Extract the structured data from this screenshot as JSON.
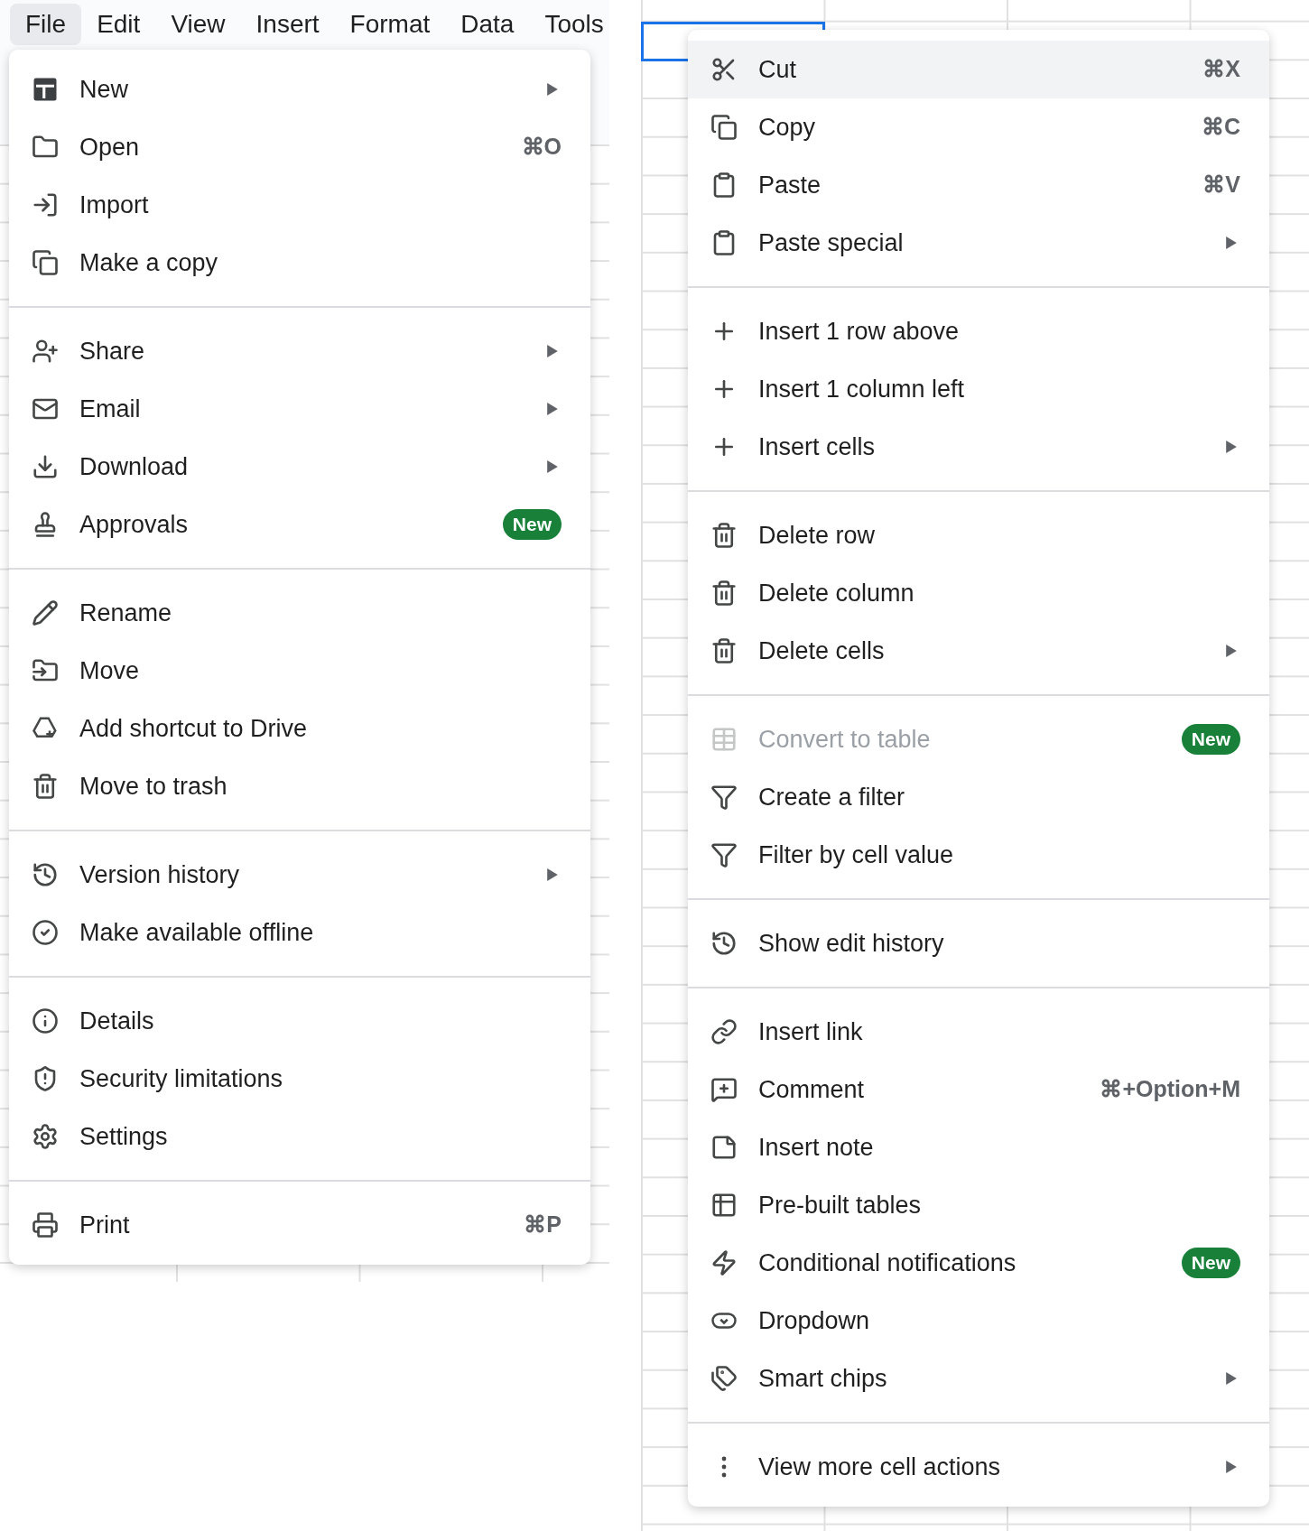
{
  "menubar": [
    {
      "label": "File",
      "selected": true
    },
    {
      "label": "Edit",
      "selected": false
    },
    {
      "label": "View",
      "selected": false
    },
    {
      "label": "Insert",
      "selected": false
    },
    {
      "label": "Format",
      "selected": false
    },
    {
      "label": "Data",
      "selected": false
    },
    {
      "label": "Tools",
      "selected": false
    }
  ],
  "file_menu": {
    "sections": [
      [
        {
          "label": "New",
          "submenu": true
        },
        {
          "label": "Open",
          "shortcut": "⌘O"
        },
        {
          "label": "Import"
        },
        {
          "label": "Make a copy"
        }
      ],
      [
        {
          "label": "Share",
          "submenu": true
        },
        {
          "label": "Email",
          "submenu": true
        },
        {
          "label": "Download",
          "submenu": true
        },
        {
          "label": "Approvals",
          "badge": "New"
        }
      ],
      [
        {
          "label": "Rename"
        },
        {
          "label": "Move"
        },
        {
          "label": "Add shortcut to Drive"
        },
        {
          "label": "Move to trash"
        }
      ],
      [
        {
          "label": "Version history",
          "submenu": true
        },
        {
          "label": "Make available offline"
        }
      ],
      [
        {
          "label": "Details"
        },
        {
          "label": "Security limitations"
        },
        {
          "label": "Settings"
        }
      ],
      [
        {
          "label": "Print",
          "shortcut": "⌘P"
        }
      ]
    ]
  },
  "context_menu": {
    "sections": [
      [
        {
          "label": "Cut",
          "shortcut": "⌘X",
          "highlighted": true
        },
        {
          "label": "Copy",
          "shortcut": "⌘C"
        },
        {
          "label": "Paste",
          "shortcut": "⌘V"
        },
        {
          "label": "Paste special",
          "submenu": true
        }
      ],
      [
        {
          "label": "Insert 1 row above"
        },
        {
          "label": "Insert 1 column left"
        },
        {
          "label": "Insert cells",
          "submenu": true
        }
      ],
      [
        {
          "label": "Delete row"
        },
        {
          "label": "Delete column"
        },
        {
          "label": "Delete cells",
          "submenu": true
        }
      ],
      [
        {
          "label": "Convert to table",
          "badge": "New",
          "disabled": true
        },
        {
          "label": "Create a filter"
        },
        {
          "label": "Filter by cell value"
        }
      ],
      [
        {
          "label": "Show edit history"
        }
      ],
      [
        {
          "label": "Insert link"
        },
        {
          "label": "Comment",
          "shortcut": "⌘+Option+M"
        },
        {
          "label": "Insert note"
        },
        {
          "label": "Pre-built tables"
        },
        {
          "label": "Conditional notifications",
          "badge": "New"
        },
        {
          "label": "Dropdown"
        },
        {
          "label": "Smart chips",
          "submenu": true
        }
      ],
      [
        {
          "label": "View more cell actions",
          "submenu": true
        }
      ]
    ]
  }
}
